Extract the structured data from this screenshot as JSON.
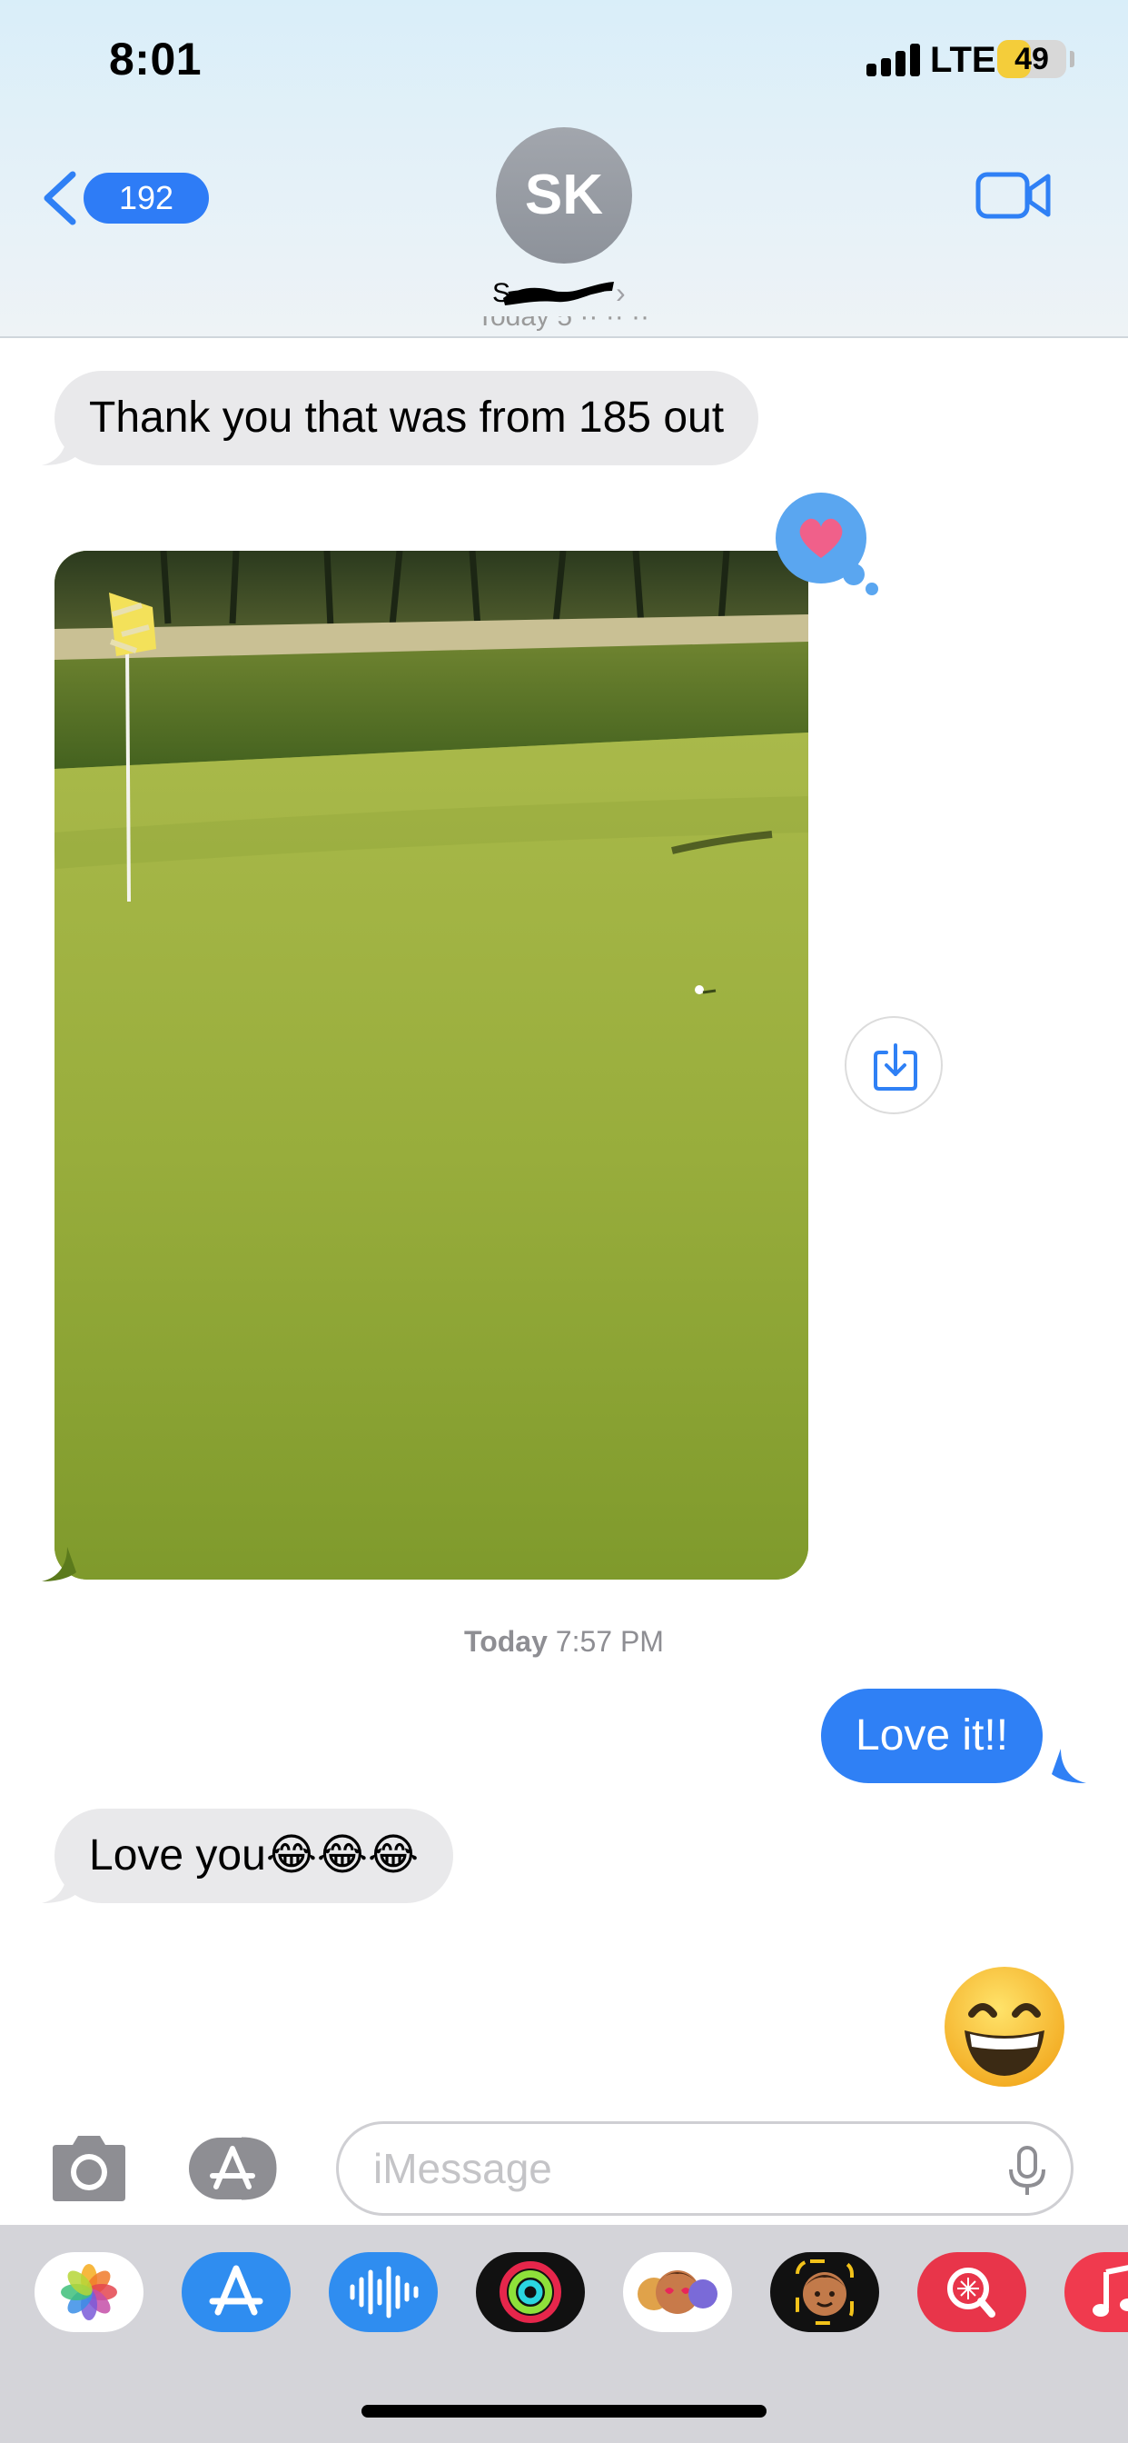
{
  "status_bar": {
    "time": "8:01",
    "network": "LTE",
    "battery": "49",
    "battery_level": 0.49
  },
  "nav": {
    "back_count": "192",
    "avatar_initials": "SK",
    "contact_name": "S"
  },
  "messages": [
    {
      "from": "them",
      "text": "Thank you that was from 185 out"
    },
    {
      "from": "them",
      "type": "photo",
      "reaction": "heart"
    },
    {
      "from": "me",
      "text": "Love it!!"
    },
    {
      "from": "them",
      "text": "Love you😂😂😂"
    },
    {
      "from": "me",
      "type": "emoji",
      "emoji": "grinning-face"
    }
  ],
  "timestamp": {
    "day": "Today",
    "time": "7:57 PM"
  },
  "composer": {
    "placeholder": "iMessage"
  },
  "app_drawer": {
    "apps": [
      "photos-icon",
      "app-store-icon",
      "audio-message-icon",
      "fitness-icon",
      "memoji-stickers-icon",
      "memoji-icon",
      "image-search-icon",
      "music-icon"
    ]
  },
  "colors": {
    "accent": "#2f80f5",
    "bubble_in": "#e9e9eb",
    "bubble_out": "#2f80f5",
    "reaction_heart": "#f0608a"
  }
}
